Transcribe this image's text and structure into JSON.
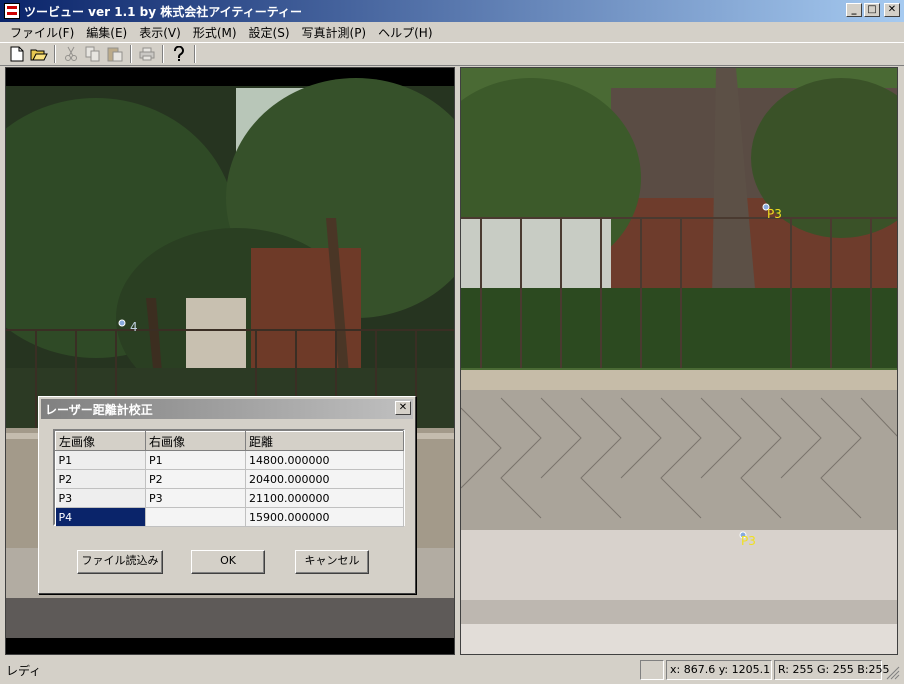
{
  "window": {
    "title": "ツービュー ver 1.1 by 株式会社アイティーティー"
  },
  "menu": {
    "file": "ファイル(F)",
    "edit": "編集(E)",
    "view": "表示(V)",
    "format": "形式(M)",
    "settings": "設定(S)",
    "photo_measure": "写真計測(P)",
    "help": "ヘルプ(H)"
  },
  "markers": {
    "left_p4": "4",
    "right_p3": "P3",
    "right_p4": "P3"
  },
  "dialog": {
    "title": "レーザー距離計校正",
    "close": "✕",
    "columns": {
      "left": "左画像",
      "right": "右画像",
      "distance": "距離"
    },
    "rows": [
      {
        "left": "P1",
        "right": "P1",
        "distance": "14800.000000"
      },
      {
        "left": "P2",
        "right": "P2",
        "distance": "20400.000000"
      },
      {
        "left": "P3",
        "right": "P3",
        "distance": "21100.000000"
      },
      {
        "left": "P4",
        "right": "",
        "distance": "15900.000000"
      }
    ],
    "buttons": {
      "load_file": "ファイル読込み",
      "ok": "OK",
      "cancel": "キャンセル"
    }
  },
  "status": {
    "text": "レディ",
    "coords": "x: 867.6 y: 1205.1",
    "rgb": "R: 255 G: 255  B:255"
  },
  "icons": [
    "new-file-icon",
    "open-folder-icon",
    "cut-icon",
    "copy-icon",
    "paste-icon",
    "print-icon",
    "help-icon"
  ]
}
